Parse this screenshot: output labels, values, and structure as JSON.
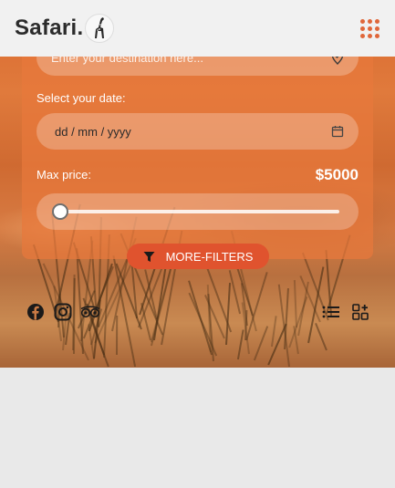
{
  "app": {
    "logo_text": "Safari."
  },
  "search": {
    "destination_placeholder": "Enter your destination here...",
    "date_label": "Select your date:",
    "date_placeholder": "dd / mm / yyyy",
    "price_label": "Max price:",
    "price_value": "$5000",
    "price_slider_fraction": 0.0
  },
  "filters": {
    "button_label": "MORE-FILTERS"
  },
  "social": {
    "icons": [
      "facebook-icon",
      "instagram-icon",
      "tripadvisor-icon"
    ]
  },
  "view_toggles": {
    "icons": [
      "list-view-icon",
      "grid-add-view-icon"
    ]
  },
  "colors": {
    "accent": "#e0673a",
    "button": "#e0532e",
    "panel": "#e8783c"
  }
}
